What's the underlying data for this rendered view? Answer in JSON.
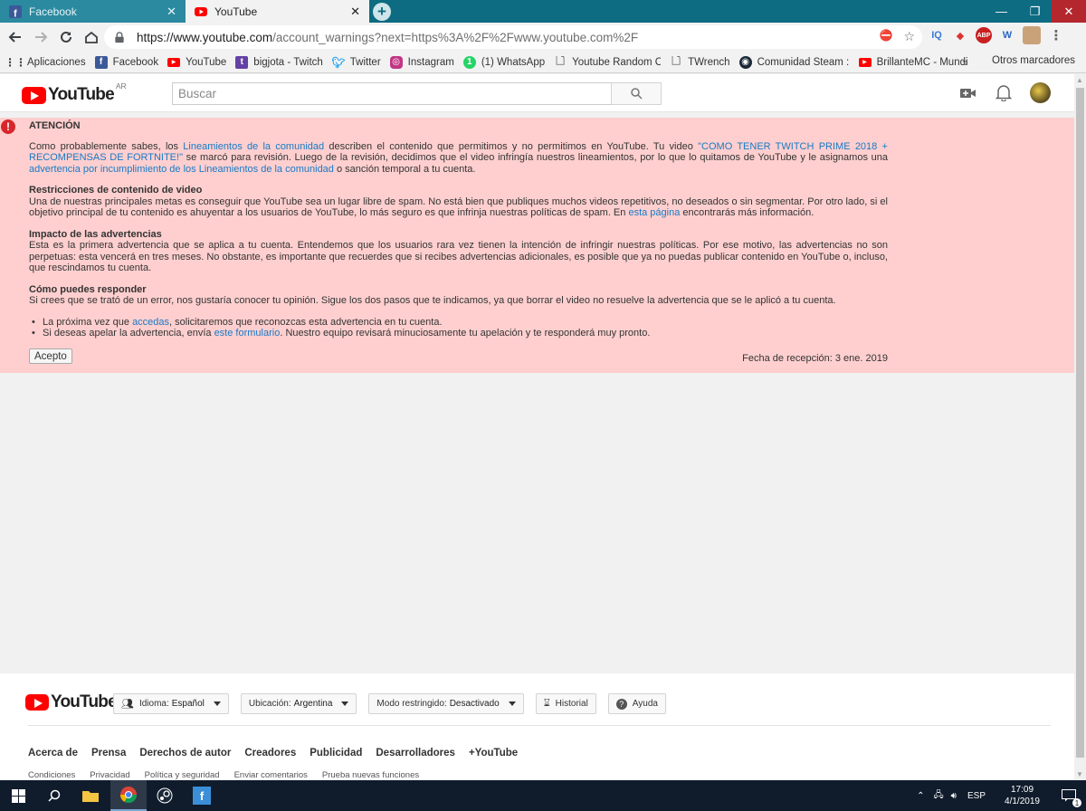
{
  "browser": {
    "tabs": [
      {
        "label": "Facebook",
        "active": false
      },
      {
        "label": "YouTube",
        "active": true
      }
    ],
    "url_host": "https://www.youtube.com",
    "url_rest": "/account_warnings?next=https%3A%2F%2Fwww.youtube.com%2F",
    "bookmarks": [
      {
        "label": "Aplicaciones",
        "icon": "apps-grid-icon"
      },
      {
        "label": "Facebook",
        "icon": "facebook-icon"
      },
      {
        "label": "YouTube",
        "icon": "youtube-icon"
      },
      {
        "label": "bigjota - Twitch",
        "icon": "twitch-icon"
      },
      {
        "label": "Twitter",
        "icon": "twitter-icon"
      },
      {
        "label": "Instagram",
        "icon": "instagram-icon"
      },
      {
        "label": "(1) WhatsApp",
        "icon": "whatsapp-icon"
      },
      {
        "label": "Youtube Random Co",
        "icon": "page-icon"
      },
      {
        "label": "TWrench",
        "icon": "page-icon"
      },
      {
        "label": "Comunidad Steam :: ",
        "icon": "steam-icon"
      },
      {
        "label": "BrillanteMC - Mundia",
        "icon": "youtube-icon"
      }
    ],
    "bookmarks_more": "»",
    "other_bookmarks": "Otros marcadores"
  },
  "masthead": {
    "logo_text": "YouTube",
    "country_code": "AR",
    "search_placeholder": "Buscar"
  },
  "warning": {
    "title": "ATENCIÓN",
    "p1_a": "Como probablemente sabes, los ",
    "p1_link1": "Lineamientos de la comunidad",
    "p1_b": " describen el contenido que permitimos y no permitimos en YouTube. Tu video ",
    "p1_link2": "\"COMO TENER TWITCH PRIME 2018 + RECOMPENSAS DE FORTNITE!\"",
    "p1_c": " se marcó para revisión. Luego de la revisión, decidimos que el video infringía nuestros lineamientos, por lo que lo quitamos de YouTube y le asignamos una ",
    "p1_link3": "advertencia por incumplimiento de los Lineamientos de la comunidad",
    "p1_d": " o sanción temporal a tu cuenta.",
    "s1_title": "Restricciones de contenido de video",
    "s1_a": "Una de nuestras principales metas es conseguir que YouTube sea un lugar libre de spam. No está bien que publiques muchos videos repetitivos, no deseados o sin segmentar. Por otro lado, si el objetivo principal de tu contenido es ahuyentar a los usuarios de YouTube, lo más seguro es que infrinja nuestras políticas de spam. En ",
    "s1_link": "esta página",
    "s1_b": " encontrarás más información.",
    "s2_title": "Impacto de las advertencias",
    "s2_text": "Esta es la primera advertencia que se aplica a tu cuenta. Entendemos que los usuarios rara vez tienen la intención de infringir nuestras políticas. Por ese motivo, las advertencias no son perpetuas: esta vencerá en tres meses. No obstante, es importante que recuerdes que si recibes advertencias adicionales, es posible que ya no puedas publicar contenido en YouTube o, incluso, que rescindamos tu cuenta.",
    "s3_title": "Cómo puedes responder",
    "s3_text": "Si crees que se trató de un error, nos gustaría conocer tu opinión. Sigue los dos pasos que te indicamos, ya que borrar el video no resuelve la advertencia que se le aplicó a tu cuenta.",
    "b1_a": "La próxima vez que ",
    "b1_link": "accedas",
    "b1_b": ", solicitaremos que reconozcas esta advertencia en tu cuenta.",
    "b2_a": "Si deseas apelar la advertencia, envía ",
    "b2_link": "este formulario",
    "b2_b": ". Nuestro equipo revisará minuciosamente tu apelación y te responderá muy pronto.",
    "accept_label": "Acepto",
    "received": "Fecha de recepción: 3 ene. 2019"
  },
  "footer": {
    "logo_text": "YouTube",
    "language_label": "Idioma:",
    "language_value": "Español",
    "location_label": "Ubicación:",
    "location_value": "Argentina",
    "restricted_label": "Modo restringido:",
    "restricted_value": "Desactivado",
    "history_label": "Historial",
    "help_label": "Ayuda",
    "links": [
      "Acerca de",
      "Prensa",
      "Derechos de autor",
      "Creadores",
      "Publicidad",
      "Desarrolladores",
      "+YouTube"
    ],
    "sublinks": [
      "Condiciones",
      "Privacidad",
      "Política y seguridad",
      "Enviar comentarios",
      "Prueba nuevas funciones"
    ]
  },
  "taskbar": {
    "language": "ESP",
    "time": "17:09",
    "date": "4/1/2019",
    "notifications": "1"
  },
  "colors": {
    "warning_bg": "#ffcfcf",
    "link": "#167ac6",
    "youtube_red": "#ff0000",
    "tab_strip": "#0d6b82"
  }
}
